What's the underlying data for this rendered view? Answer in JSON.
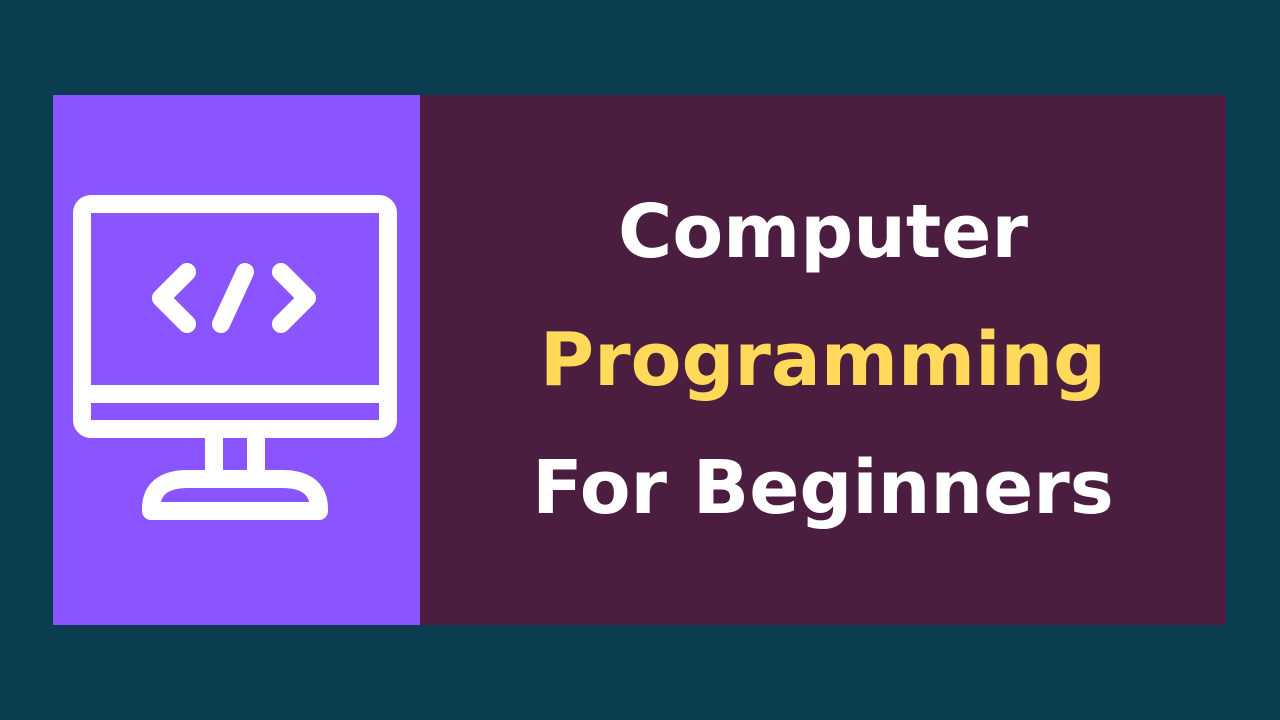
{
  "colors": {
    "background": "#093D4F",
    "icon_panel": "#8A55FE",
    "title_panel": "#4B1D3F",
    "title_white": "#FFFFFF",
    "title_highlight": "#FFD95A"
  },
  "icon": {
    "name": "monitor-code-icon"
  },
  "title": {
    "line1": "Computer",
    "line2": "Programming",
    "line3": "For Beginners"
  }
}
